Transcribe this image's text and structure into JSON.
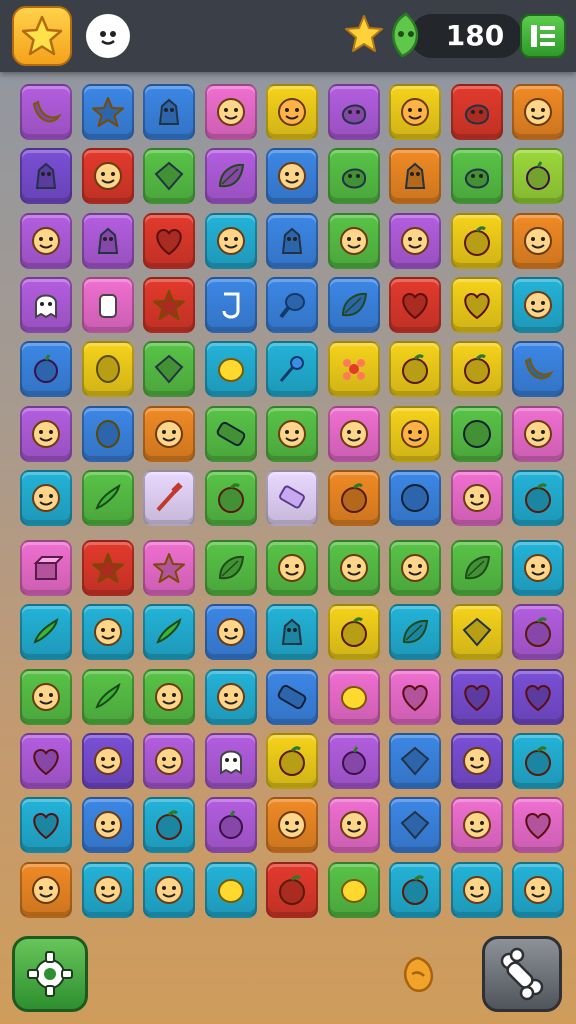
{
  "hud": {
    "score": "180"
  },
  "colors": {
    "purple": "#b35ee0",
    "blue": "#3c87e6",
    "pink": "#ef6fd0",
    "yellow": "#f5d21b",
    "green": "#58c347",
    "orange": "#f08a25",
    "red": "#e23a2c",
    "teal": "#23b3d8",
    "violet": "#7a4fd6",
    "lime": "#9bd83a",
    "lilac": "#e9d8ff"
  },
  "board": {
    "rows": [
      [
        [
          "purple",
          "banana-icon"
        ],
        [
          "blue",
          "star-icon"
        ],
        [
          "blue",
          "creature-icon"
        ],
        [
          "pink",
          "face-icon"
        ],
        [
          "yellow",
          "face-icon"
        ],
        [
          "purple",
          "blob-icon"
        ],
        [
          "yellow",
          "face-icon"
        ],
        [
          "red",
          "blob-icon"
        ],
        [
          "orange",
          "face-icon"
        ]
      ],
      [
        [
          "violet",
          "creature-icon"
        ],
        [
          "red",
          "face-icon"
        ],
        [
          "green",
          "gem-icon"
        ],
        [
          "purple",
          "leaf-icon"
        ],
        [
          "blue",
          "face-icon"
        ],
        [
          "green",
          "blob-icon"
        ],
        [
          "orange",
          "creature-icon"
        ],
        [
          "green",
          "blob-icon"
        ],
        [
          "lime",
          "berry-icon"
        ]
      ],
      [
        [
          "purple",
          "face-icon"
        ],
        [
          "purple",
          "creature-icon"
        ],
        [
          "red",
          "heart-icon"
        ],
        [
          "teal",
          "face-icon"
        ],
        [
          "blue",
          "creature-icon"
        ],
        [
          "green",
          "face-icon"
        ],
        [
          "purple",
          "face-icon"
        ],
        [
          "yellow",
          "apple-icon"
        ],
        [
          "orange",
          "face-icon"
        ]
      ],
      [
        [
          "purple",
          "ghost-icon"
        ],
        [
          "pink",
          "cup-icon"
        ],
        [
          "red",
          "star-icon"
        ],
        [
          "blue",
          "hook-icon"
        ],
        [
          "blue",
          "drumstick-icon"
        ],
        [
          "blue",
          "leaf-icon"
        ],
        [
          "red",
          "heart-icon"
        ],
        [
          "yellow",
          "heart-icon"
        ],
        [
          "teal",
          "face-icon"
        ]
      ],
      [
        [
          "blue",
          "berry-icon"
        ],
        [
          "yellow",
          "egg-icon"
        ],
        [
          "green",
          "gem-icon"
        ],
        [
          "teal",
          "lemon-icon"
        ],
        [
          "teal",
          "pin-icon"
        ],
        [
          "yellow",
          "flower-icon"
        ],
        [
          "yellow",
          "apple-icon"
        ],
        [
          "yellow",
          "apple-icon"
        ],
        [
          "blue",
          "banana-icon"
        ]
      ],
      [
        [
          "purple",
          "face-icon"
        ],
        [
          "blue",
          "egg-icon"
        ],
        [
          "orange",
          "face-icon"
        ],
        [
          "green",
          "bar-icon"
        ],
        [
          "green",
          "face-icon"
        ],
        [
          "pink",
          "face-icon"
        ],
        [
          "yellow",
          "face-icon"
        ],
        [
          "green",
          "ball-icon"
        ],
        [
          "pink",
          "face-icon"
        ]
      ],
      [
        [
          "teal",
          "face-icon"
        ],
        [
          "green",
          "pepper-icon"
        ],
        [
          "lilac",
          "stick-icon"
        ],
        [
          "green",
          "apple-icon"
        ],
        [
          "lilac",
          "eraser-icon"
        ],
        [
          "orange",
          "apple-icon"
        ],
        [
          "blue",
          "ball-icon"
        ],
        [
          "pink",
          "face-icon"
        ],
        [
          "teal",
          "apple-icon"
        ]
      ],
      [
        [
          "pink",
          "box-icon"
        ],
        [
          "red",
          "star-icon"
        ],
        [
          "pink",
          "star-icon"
        ],
        [
          "green",
          "leaf-icon"
        ],
        [
          "green",
          "face-icon"
        ],
        [
          "green",
          "face-icon"
        ],
        [
          "green",
          "face-icon"
        ],
        [
          "green",
          "leaf-icon"
        ],
        [
          "teal",
          "face-icon"
        ]
      ],
      [
        [
          "teal",
          "pepper-icon"
        ],
        [
          "teal",
          "face-icon"
        ],
        [
          "teal",
          "pepper-icon"
        ],
        [
          "blue",
          "face-icon"
        ],
        [
          "teal",
          "creature-icon"
        ],
        [
          "yellow",
          "apple-icon"
        ],
        [
          "teal",
          "leaf-icon"
        ],
        [
          "yellow",
          "gem-icon"
        ],
        [
          "purple",
          "apple-icon"
        ]
      ],
      [
        [
          "green",
          "face-icon"
        ],
        [
          "green",
          "pepper-icon"
        ],
        [
          "green",
          "face-icon"
        ],
        [
          "teal",
          "face-icon"
        ],
        [
          "blue",
          "bar-icon"
        ],
        [
          "pink",
          "lemon-icon"
        ],
        [
          "pink",
          "heart-icon"
        ],
        [
          "violet",
          "heart-icon"
        ],
        [
          "violet",
          "heart-icon"
        ]
      ],
      [
        [
          "purple",
          "heart-icon"
        ],
        [
          "violet",
          "face-icon"
        ],
        [
          "purple",
          "face-icon"
        ],
        [
          "purple",
          "ghost-icon"
        ],
        [
          "yellow",
          "apple-icon"
        ],
        [
          "purple",
          "berry-icon"
        ],
        [
          "blue",
          "gem-icon"
        ],
        [
          "violet",
          "face-icon"
        ],
        [
          "teal",
          "apple-icon"
        ]
      ],
      [
        [
          "teal",
          "heart-icon"
        ],
        [
          "blue",
          "face-icon"
        ],
        [
          "teal",
          "apple-icon"
        ],
        [
          "purple",
          "berry-icon"
        ],
        [
          "orange",
          "face-icon"
        ],
        [
          "pink",
          "face-icon"
        ],
        [
          "blue",
          "gem-icon"
        ],
        [
          "pink",
          "face-icon"
        ],
        [
          "pink",
          "heart-icon"
        ]
      ],
      [
        [
          "orange",
          "face-icon"
        ],
        [
          "teal",
          "face-icon"
        ],
        [
          "teal",
          "face-icon"
        ],
        [
          "teal",
          "lemon-icon"
        ],
        [
          "red",
          "apple-icon"
        ],
        [
          "green",
          "lemon-icon"
        ],
        [
          "teal",
          "apple-icon"
        ],
        [
          "teal",
          "face-icon"
        ],
        [
          "teal",
          "face-icon"
        ]
      ]
    ]
  }
}
